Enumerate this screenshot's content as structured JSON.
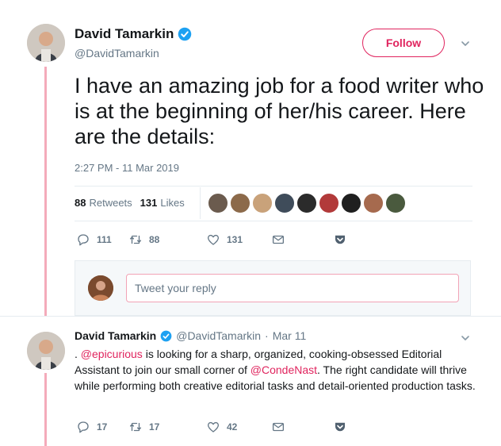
{
  "main_tweet": {
    "author_name": "David Tamarkin",
    "author_handle": "@DavidTamarkin",
    "follow_label": "Follow",
    "text": "I have an amazing job for a food writer who is at the beginning of her/his career. Here are the details:",
    "timestamp": "2:27 PM - 11 Mar 2019",
    "retweets_count": "88",
    "retweets_label": "Retweets",
    "likes_count": "131",
    "likes_label": "Likes",
    "actions": {
      "replies": "111",
      "retweets": "88",
      "likes": "131"
    }
  },
  "reply_box": {
    "placeholder": "Tweet your reply"
  },
  "reply_tweet": {
    "author_name": "David Tamarkin",
    "author_handle": "@DavidTamarkin",
    "separator": "·",
    "date": "Mar 11",
    "text_prefix": ". ",
    "mention_1": "@epicurious",
    "text_mid": " is looking for a sharp, organized, cooking-obsessed Editorial Assistant to join our small corner of ",
    "mention_2": "@CondeNast",
    "text_suffix": ". The right candidate will thrive while performing both creative editorial tasks and detail-oriented production tasks.",
    "actions": {
      "replies": "17",
      "retweets": "17",
      "likes": "42"
    }
  },
  "colors": {
    "accent": "#e0245e",
    "verified": "#1da1f2",
    "thread_line": "#f4abba",
    "secondary_text": "#657786",
    "liker_avatars": [
      "#6b5b4e",
      "#8c6a4a",
      "#c9a27a",
      "#3f4c5a",
      "#2b2b2b",
      "#b23a3a",
      "#1f1f1f",
      "#a66a4e",
      "#4a5a3e"
    ]
  },
  "icons": [
    "verified-icon",
    "chevron-down-icon",
    "reply-icon",
    "retweet-icon",
    "like-icon",
    "message-icon",
    "pocket-icon"
  ]
}
